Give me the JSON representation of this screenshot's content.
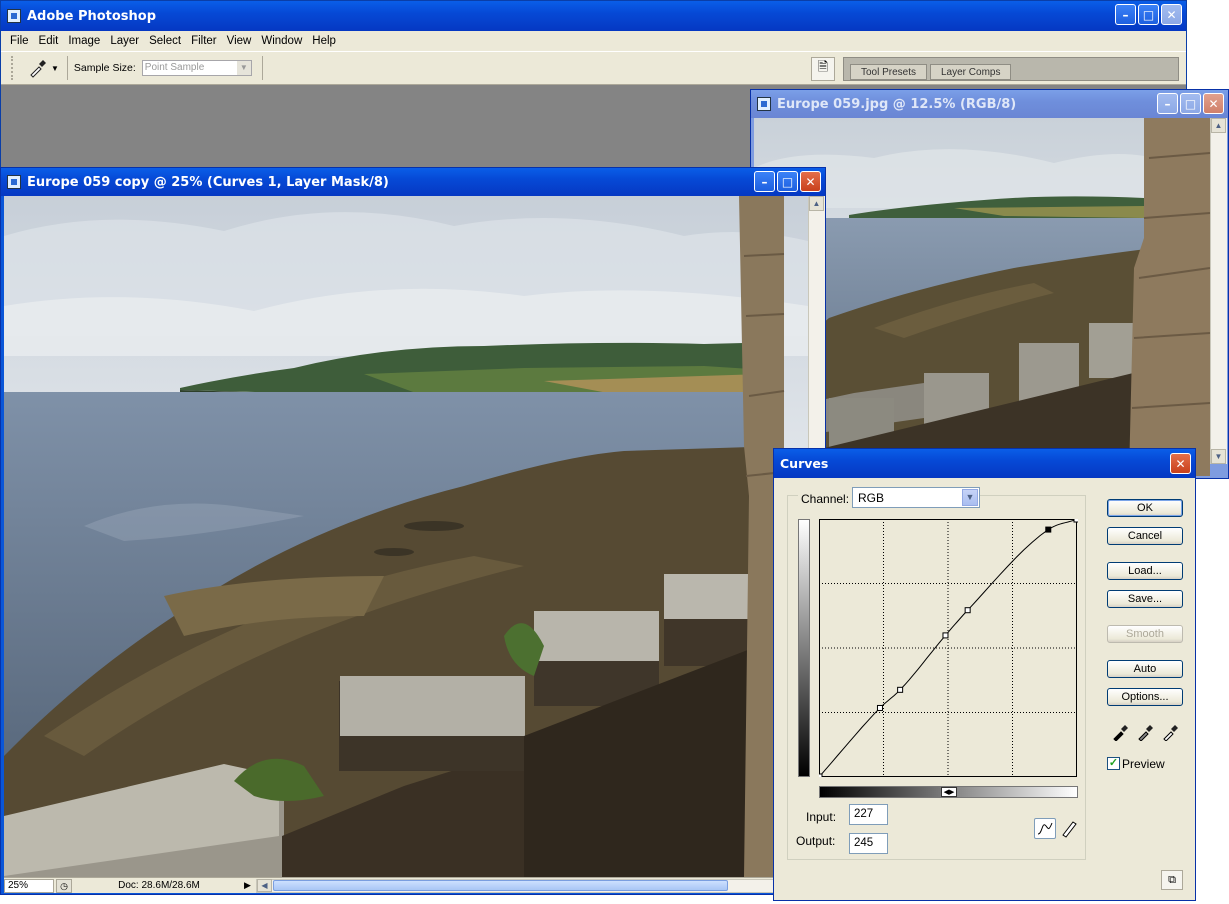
{
  "app": {
    "title": "Adobe Photoshop",
    "menu": [
      "File",
      "Edit",
      "Image",
      "Layer",
      "Select",
      "Filter",
      "View",
      "Window",
      "Help"
    ],
    "options": {
      "sample_size_label": "Sample Size:",
      "sample_size_value": "Point Sample"
    },
    "palette_tabs": [
      "Tool Presets",
      "Layer Comps"
    ]
  },
  "doc_main": {
    "title": "Europe 059 copy @ 25% (Curves 1, Layer Mask/8)",
    "status": {
      "zoom": "25%",
      "doc_info": "Doc: 28.6M/28.6M"
    }
  },
  "doc_small": {
    "title": "Europe 059.jpg @ 12.5% (RGB/8)"
  },
  "curves": {
    "title": "Curves",
    "channel_label": "Channel:",
    "channel_value": "RGB",
    "buttons": {
      "ok": "OK",
      "cancel": "Cancel",
      "load": "Load...",
      "save": "Save...",
      "smooth": "Smooth",
      "auto": "Auto",
      "options": "Options..."
    },
    "preview_label": "Preview",
    "preview_checked": true,
    "input_label": "Input:",
    "output_label": "Output:",
    "input_value": "227",
    "output_value": "245",
    "curve_points": [
      [
        0,
        0
      ],
      [
        60,
        68
      ],
      [
        80,
        86
      ],
      [
        125,
        140
      ],
      [
        147,
        165
      ],
      [
        227,
        245
      ],
      [
        255,
        255
      ]
    ]
  }
}
